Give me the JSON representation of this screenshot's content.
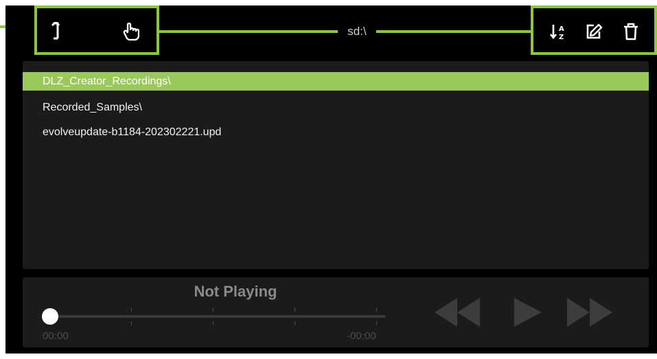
{
  "header": {
    "path": "sd:\\",
    "icons": {
      "up": "up-arrow-icon",
      "touch": "pointer-hand-icon",
      "sort": "sort-az-icon",
      "edit": "edit-icon",
      "delete": "trash-icon"
    }
  },
  "files": [
    {
      "name": "DLZ_Creator_Recordings\\",
      "selected": true
    },
    {
      "name": "Recorded_Samples\\",
      "selected": false
    },
    {
      "name": "evolveupdate-b1184-202302221.upd",
      "selected": false
    }
  ],
  "player": {
    "status": "Not Playing",
    "elapsed": "00:00",
    "remaining": "-00:00",
    "progress": 0,
    "controls": [
      "rewind-icon",
      "play-icon",
      "fast-forward-icon"
    ]
  },
  "colors": {
    "accent": "#8dc63f",
    "selected_row": "#9bc85a",
    "panel": "#1b1b1b",
    "background": "#000000"
  }
}
